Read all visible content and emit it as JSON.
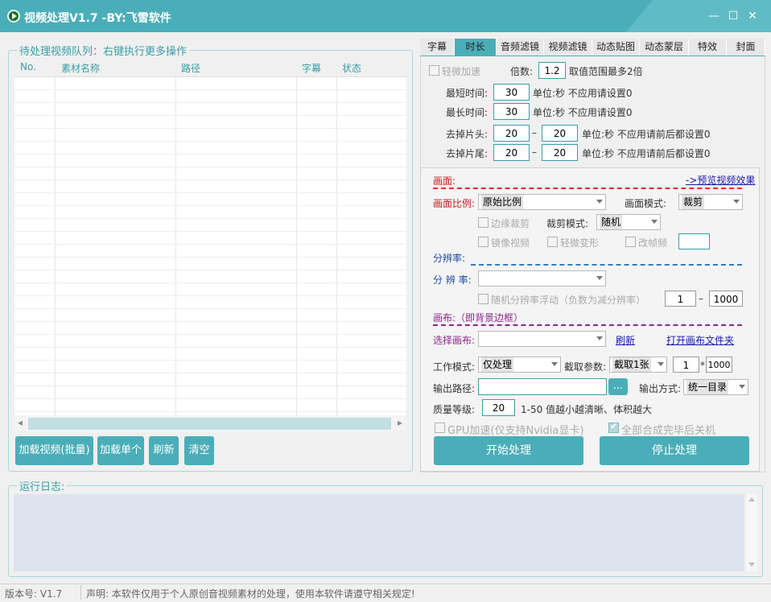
{
  "window": {
    "title": "视频处理V1.7 -BY:飞雪软件",
    "minimize": "—",
    "maximize": "☐",
    "close": "✕",
    "accent": "#4aaeb8"
  },
  "queue": {
    "legend": "待处理视频队列：右键执行更多操作",
    "columns": [
      "No.",
      "素材名称",
      "路径",
      "字幕",
      "状态"
    ],
    "scroll_left": "◂",
    "scroll_right": "▸"
  },
  "queue_buttons": {
    "load_batch": "加载视频(批量)",
    "load_single": "加载单个",
    "refresh": "刷新",
    "clear": "清空"
  },
  "tabs": [
    "字幕",
    "时长",
    "音频滤镜",
    "视频滤镜",
    "动态贴图",
    "动态蒙层",
    "特效",
    "封面"
  ],
  "active_tab": "时长",
  "duration": {
    "speed_label": "轻微加速",
    "multiple_label": "倍数:",
    "multiple_value": "1.2",
    "multiple_hint": "取值范围最多2倍",
    "min_label": "最短时间:",
    "min_value": "30",
    "min_unit": "单位:秒   不应用请设置0",
    "max_label": "最长时间:",
    "max_value": "30",
    "max_unit": "单位:秒   不应用请设置0",
    "head_label": "去掉片头:",
    "head_from": "20",
    "head_dash": "–",
    "head_to": "20",
    "head_unit": "单位:秒   不应用请前后都设置0",
    "tail_label": "去掉片尾:",
    "tail_from": "20",
    "tail_dash": "–",
    "tail_to": "20",
    "tail_unit": "单位:秒   不应用请前后都设置0"
  },
  "picture": {
    "section_label": "画面:",
    "preview_link": "->预览视频效果",
    "ratio_label": "画面比例:",
    "ratio_value": "原始比例",
    "mode_label": "画面模式:",
    "mode_value": "裁剪",
    "edge_crop": "边缘裁剪",
    "crop_mode_label": "裁剪模式:",
    "crop_mode_value": "随机",
    "mirror": "镜像视频",
    "slight_deform": "轻微变形",
    "change_fps": "改帧频",
    "fps_value": ""
  },
  "resolution": {
    "section_label": "分辨率:",
    "res_label": "分 辨 率:",
    "res_value": "",
    "random_label": "随机分辨率浮动（负数为减分辨率）",
    "random_from": "1",
    "random_dash": "–",
    "random_to": "1000"
  },
  "canvas": {
    "section_label": "画布:（即背景边框）",
    "select_label": "选择画布:",
    "select_value": "",
    "refresh_link": "刷新",
    "open_folder_link": "打开画布文件夹"
  },
  "work": {
    "mode_label": "工作模式:",
    "mode_value": "仅处理",
    "capture_label": "截取参数:",
    "capture_value": "截取1张",
    "capture_a": "1",
    "capture_times": "*",
    "capture_b": "1000",
    "output_path_label": "输出路径:",
    "output_path_value": "",
    "browse": "...",
    "output_mode_label": "输出方式:",
    "output_mode_value": "统一目录",
    "quality_label": "质量等级:",
    "quality_value": "20",
    "quality_hint": "1-50 值越小越清晰、体积越大",
    "gpu_label": "GPU加速(仅支持Nvidia显卡)",
    "shutdown_label": "全部合成完毕后关机",
    "start_button": "开始处理",
    "stop_button": "停止处理"
  },
  "log": {
    "legend": "运行日志:"
  },
  "status": {
    "version": "版本号: V1.7",
    "notice": "声明: 本软件仅用于个人原创音视频素材的处理，使用本软件请遵守相关规定!"
  }
}
